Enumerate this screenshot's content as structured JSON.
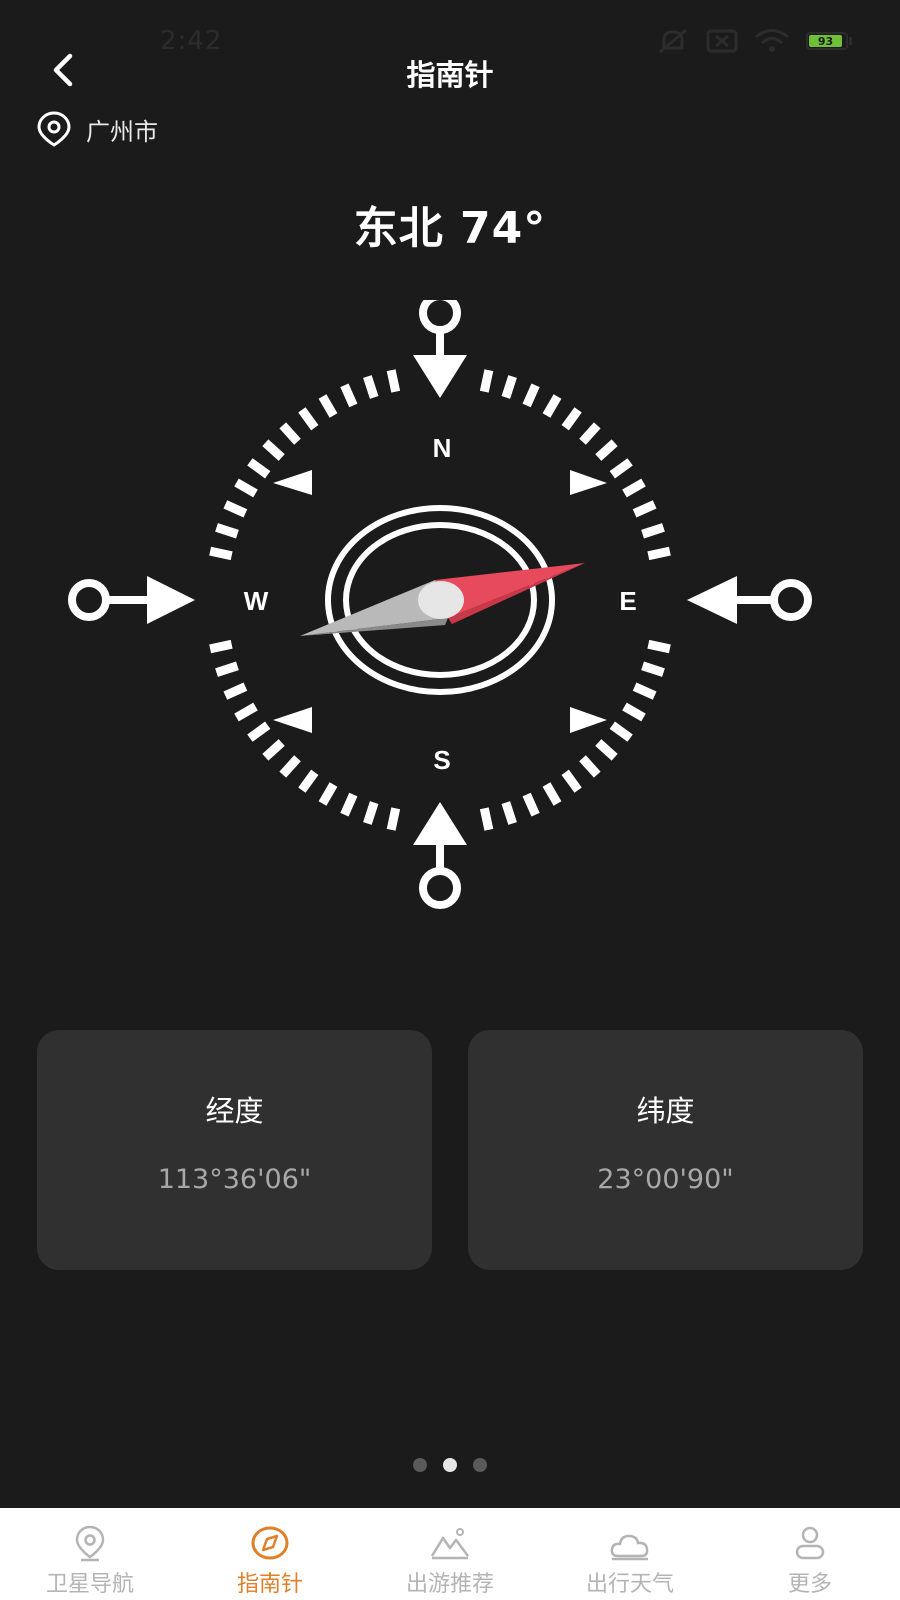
{
  "status_bar": {
    "time": "2:42",
    "battery": "93"
  },
  "header": {
    "title": "指南针"
  },
  "location": {
    "city": "广州市"
  },
  "heading": {
    "text": "东北 74°"
  },
  "compass": {
    "directions": {
      "north": "N",
      "south": "S",
      "east": "E",
      "west": "W"
    },
    "needle_angle_deg": 74,
    "colors": {
      "needle_north": "#e64a5c",
      "needle_south": "#b9b9b9",
      "dial": "#ffffff"
    }
  },
  "coordinates": {
    "longitude": {
      "label": "经度",
      "value": "113°36'06\""
    },
    "latitude": {
      "label": "纬度",
      "value": "23°00'90\""
    }
  },
  "pagination": {
    "total": 3,
    "active": 2
  },
  "tab_bar": {
    "active_color": "#e0802a",
    "tabs": [
      {
        "label": "卫星导航",
        "icon": "location-pin-icon"
      },
      {
        "label": "指南针",
        "icon": "compass-icon"
      },
      {
        "label": "出游推荐",
        "icon": "mountain-icon"
      },
      {
        "label": "出行天气",
        "icon": "cloud-sun-icon"
      },
      {
        "label": "更多",
        "icon": "user-icon"
      }
    ]
  }
}
